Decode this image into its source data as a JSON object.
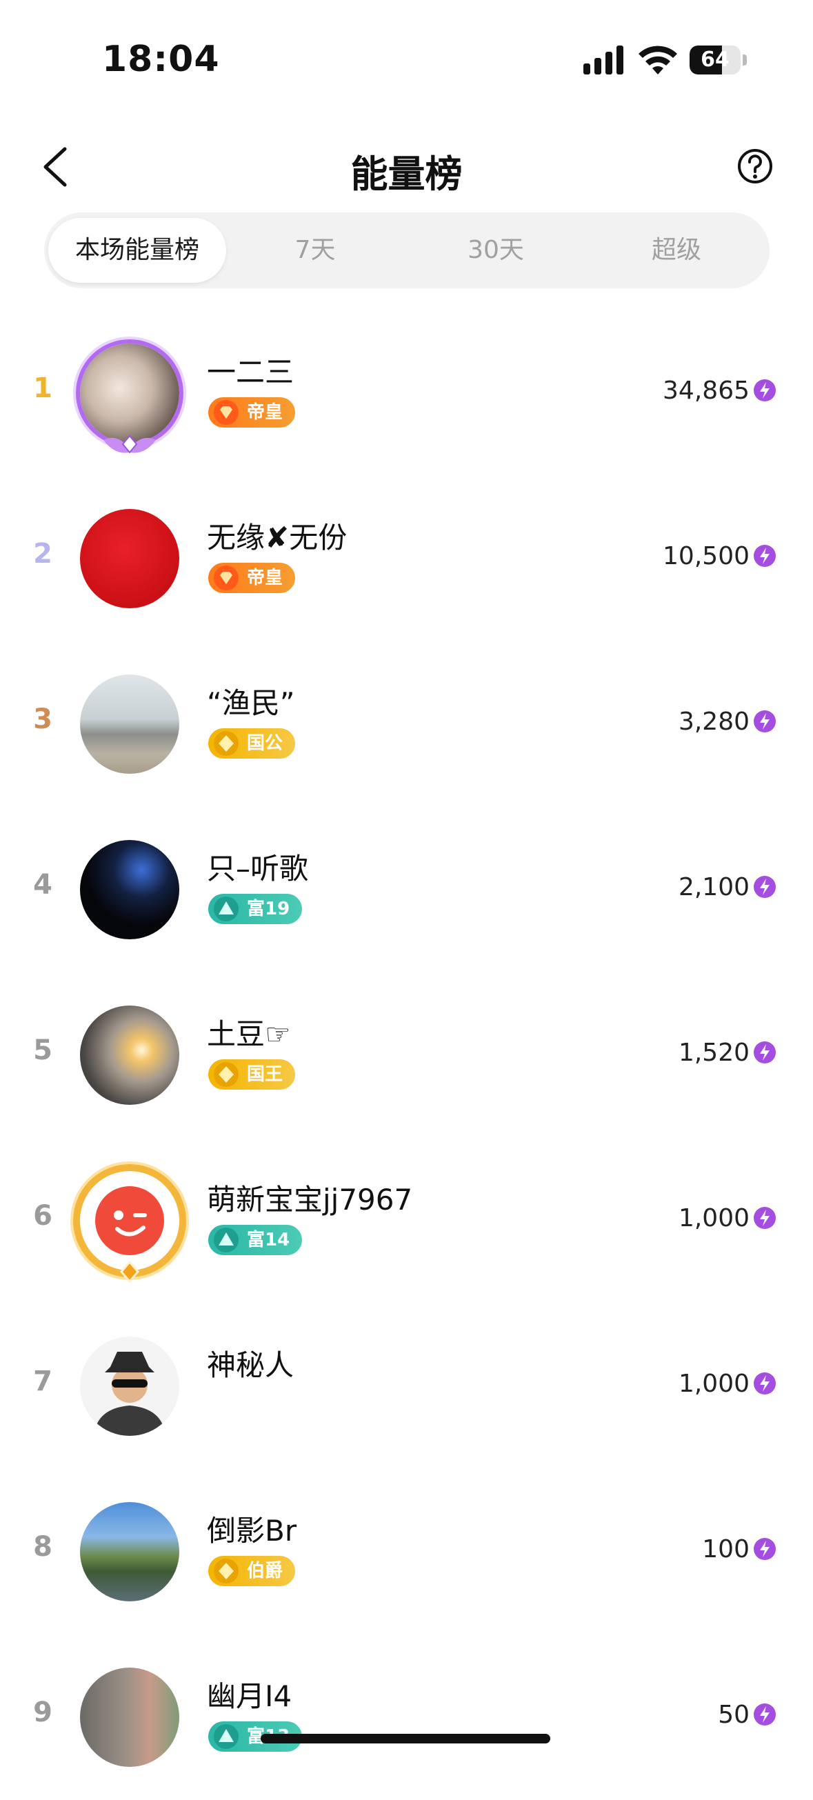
{
  "status_bar": {
    "time": "18:04",
    "battery": "64",
    "battery_level": 0.64
  },
  "header": {
    "title": "能量榜"
  },
  "tabs": [
    {
      "label": "本场能量榜",
      "active": true
    },
    {
      "label": "7天",
      "active": false
    },
    {
      "label": "30天",
      "active": false
    },
    {
      "label": "超级",
      "active": false
    }
  ],
  "colors": {
    "rank1": "#f0b429",
    "rank2": "#b8b4ee",
    "rank3": "#d08c55",
    "rank_other": "#9a9a9a",
    "energy": "#a44de0"
  },
  "rows": [
    {
      "rank": "1",
      "name": "一二三",
      "badge": "帝皇",
      "badge_style": "orange",
      "score": "34,865",
      "frame": "purple"
    },
    {
      "rank": "2",
      "name": "无缘✘无份",
      "badge": "帝皇",
      "badge_style": "orange",
      "score": "10,500",
      "frame": "none"
    },
    {
      "rank": "3",
      "name": "“渔民”",
      "badge": "国公",
      "badge_style": "gold",
      "score": "3,280",
      "frame": "none"
    },
    {
      "rank": "4",
      "name": "只–听歌",
      "badge": "富19",
      "badge_style": "teal",
      "score": "2,100",
      "frame": "none"
    },
    {
      "rank": "5",
      "name": "土豆☞",
      "badge": "国王",
      "badge_style": "gold",
      "score": "1,520",
      "frame": "none"
    },
    {
      "rank": "6",
      "name": "萌新宝宝jj7967",
      "badge": "富14",
      "badge_style": "teal",
      "score": "1,000",
      "frame": "gold"
    },
    {
      "rank": "7",
      "name": "神秘人",
      "badge": "",
      "badge_style": "",
      "score": "1,000",
      "frame": "none"
    },
    {
      "rank": "8",
      "name": "倒影Br",
      "badge": "伯爵",
      "badge_style": "gold",
      "score": "100",
      "frame": "none"
    },
    {
      "rank": "9",
      "name": "幽月I4",
      "badge": "富13",
      "badge_style": "teal",
      "score": "50",
      "frame": "none"
    }
  ]
}
